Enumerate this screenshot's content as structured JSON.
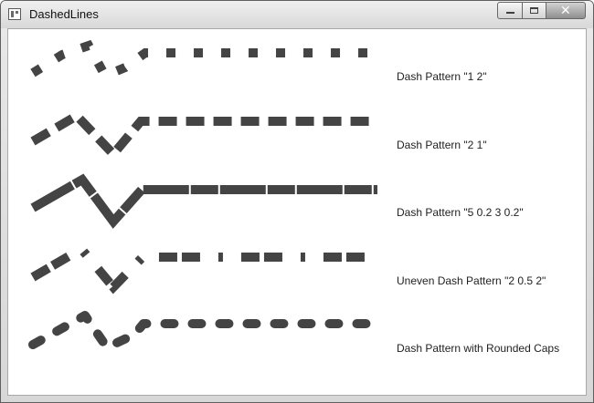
{
  "window": {
    "title": "DashedLines",
    "buttons": {
      "minimize": "minimize-icon",
      "maximize": "maximize-icon",
      "close": "close-icon"
    }
  },
  "main": {
    "patterns": [
      {
        "label": "Dash Pattern \"1 2\"",
        "dash_pattern": "1 2",
        "cap": "flat"
      },
      {
        "label": "Dash Pattern \"2 1\"",
        "dash_pattern": "2 1",
        "cap": "flat"
      },
      {
        "label": "Dash Pattern \"5 0.2 3 0.2\"",
        "dash_pattern": "5 0.2 3 0.2",
        "cap": "flat"
      },
      {
        "label": "Uneven Dash Pattern \"2 0.5 2\"",
        "dash_pattern": "2 0.5 2",
        "cap": "flat"
      },
      {
        "label": "Dash Pattern with Rounded Caps",
        "dash_pattern": "2 2",
        "cap": "round"
      }
    ],
    "stroke_color": "#444444"
  }
}
